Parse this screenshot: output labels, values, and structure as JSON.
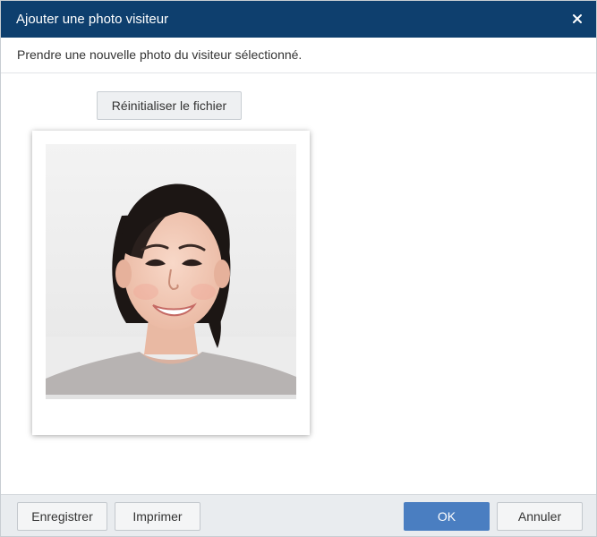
{
  "dialog": {
    "title": "Ajouter une photo visiteur",
    "close_icon": "close-icon",
    "subtitle": "Prendre une nouvelle photo du visiteur sélectionné."
  },
  "main": {
    "reset_label": "Réinitialiser le fichier",
    "photo_alt": "visitor-portrait-photo"
  },
  "footer": {
    "save_label": "Enregistrer",
    "print_label": "Imprimer",
    "ok_label": "OK",
    "cancel_label": "Annuler"
  },
  "colors": {
    "titlebar": "#0e3f6e",
    "primary_button": "#4a7ec1",
    "footer": "#e9ecef"
  }
}
